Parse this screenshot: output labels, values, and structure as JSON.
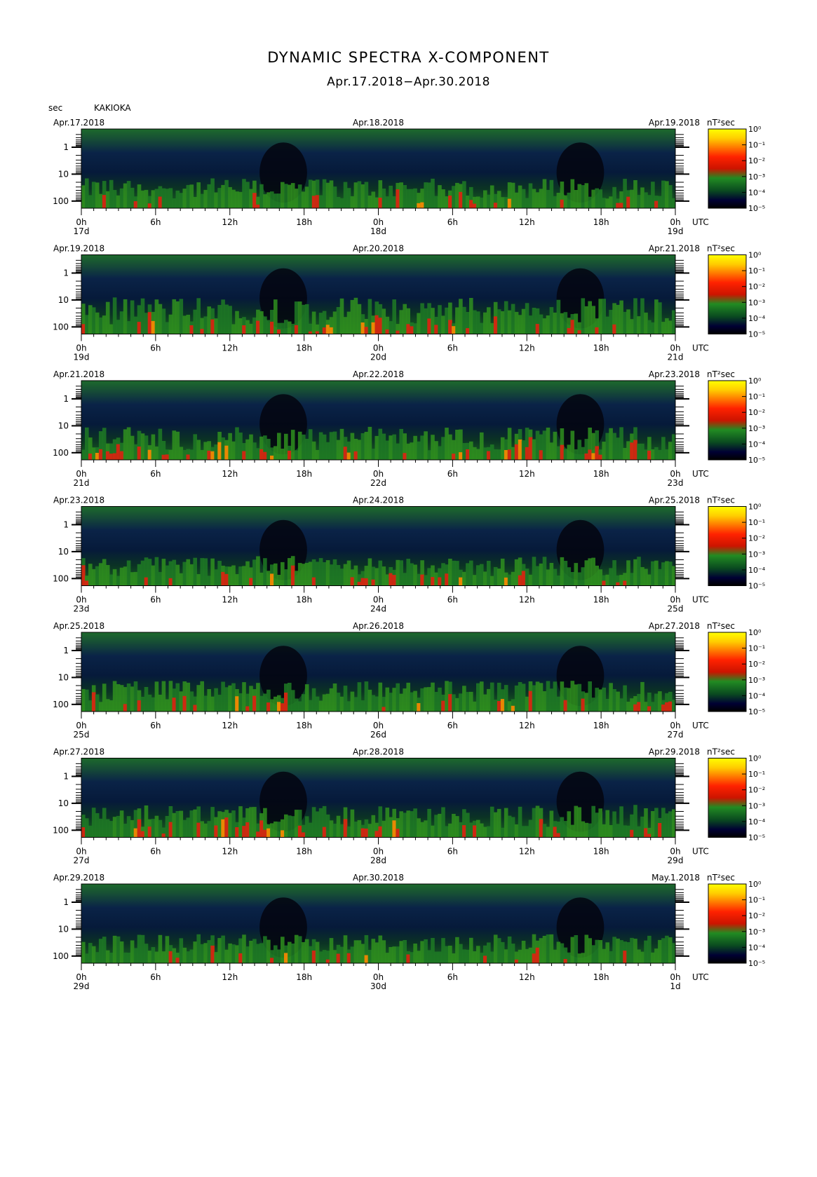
{
  "header": {
    "title": "DYNAMIC SPECTRA X-COMPONENT",
    "subtitle": "Apr.17.2018−Apr.30.2018",
    "y_unit": "sec",
    "station": "KAKIOKA"
  },
  "chart_data": {
    "type": "heatmap",
    "y_axis": {
      "label": "sec",
      "scale": "log",
      "ticks": [
        "1",
        "10",
        "100"
      ],
      "inverted": true
    },
    "x_axis": {
      "ticks": [
        "0h",
        "6h",
        "12h",
        "18h",
        "0h",
        "6h",
        "12h",
        "18h",
        "0h"
      ],
      "suffix": "UTC"
    },
    "colorbar": {
      "unit": "nT²sec",
      "scale": "log",
      "range_exponents": [
        -5,
        0
      ],
      "tick_labels": [
        "10⁰",
        "10⁻¹",
        "10⁻²",
        "10⁻³",
        "10⁻⁴",
        "10⁻⁵"
      ],
      "colors": [
        "#ffff00",
        "#ffcc00",
        "#ff2200",
        "#cc1400",
        "#228b22",
        "#0a4a20",
        "#000033",
        "#000000"
      ]
    },
    "panels": [
      {
        "date_left": "Apr.17.2018",
        "date_mid": "Apr.18.2018",
        "date_right": "Apr.19.2018",
        "day_labels": [
          "17d",
          "18d",
          "19d"
        ],
        "activity": 0.35
      },
      {
        "date_left": "Apr.19.2018",
        "date_mid": "Apr.20.2018",
        "date_right": "Apr.21.2018",
        "day_labels": [
          "19d",
          "20d",
          "21d"
        ],
        "activity": 0.75
      },
      {
        "date_left": "Apr.21.2018",
        "date_mid": "Apr.22.2018",
        "date_right": "Apr.23.2018",
        "day_labels": [
          "21d",
          "22d",
          "23d"
        ],
        "activity": 0.55
      },
      {
        "date_left": "Apr.23.2018",
        "date_mid": "Apr.24.2018",
        "date_right": "Apr.25.2018",
        "day_labels": [
          "23d",
          "24d",
          "25d"
        ],
        "activity": 0.35
      },
      {
        "date_left": "Apr.25.2018",
        "date_mid": "Apr.26.2018",
        "date_right": "Apr.27.2018",
        "day_labels": [
          "25d",
          "26d",
          "27d"
        ],
        "activity": 0.4
      },
      {
        "date_left": "Apr.27.2018",
        "date_mid": "Apr.28.2018",
        "date_right": "Apr.29.2018",
        "day_labels": [
          "27d",
          "28d",
          "29d"
        ],
        "activity": 0.5
      },
      {
        "date_left": "Apr.29.2018",
        "date_mid": "Apr.30.2018",
        "date_right": "May.1.2018",
        "day_labels": [
          "29d",
          "30d",
          "1d"
        ],
        "activity": 0.3
      }
    ]
  }
}
